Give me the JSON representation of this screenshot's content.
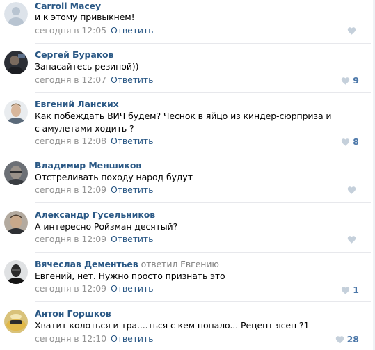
{
  "comments": [
    {
      "author": "Carroll Macey",
      "reply_to": "",
      "text": "и к этому привыкнем!",
      "time": "сегодня в 12:05",
      "reply_label": "Ответить",
      "likes": "",
      "avatar": "avatar-default"
    },
    {
      "author": "Сергей Бураков",
      "reply_to": "",
      "text": "Запасайтесь резиной))",
      "time": "сегодня в 12:07",
      "reply_label": "Ответить",
      "likes": "9",
      "avatar": "avatar-photo"
    },
    {
      "author": "Евгений Ланских",
      "reply_to": "",
      "text": "Как побеждать ВИЧ будем? Чеснок в яйцо из киндер-сюрприза и с амулетами ходить ?",
      "time": "сегодня в 12:08",
      "reply_label": "Ответить",
      "likes": "8",
      "avatar": "avatar-photo"
    },
    {
      "author": "Владимир Меншиков",
      "reply_to": "",
      "text": "Отстреливать походу народ будут",
      "time": "сегодня в 12:09",
      "reply_label": "Ответить",
      "likes": "",
      "avatar": "avatar-photo"
    },
    {
      "author": "Александр Гусельников",
      "reply_to": "",
      "text": "А интересно Ройзман десятый?",
      "time": "сегодня в 12:09",
      "reply_label": "Ответить",
      "likes": "",
      "avatar": "avatar-photo"
    },
    {
      "author": "Вячеслав Дементьев",
      "reply_to": "ответил Евгению",
      "text": "Евгений, нет. Нужно просто признать это",
      "time": "сегодня в 12:09",
      "reply_label": "Ответить",
      "likes": "1",
      "avatar": "avatar-photo"
    },
    {
      "author": "Антон Горшков",
      "reply_to": "",
      "text": "Хватит колоться и тра....ться с кем попало... Рецепт ясен ?1",
      "time": "сегодня в 12:10",
      "reply_label": "Ответить",
      "likes": "28",
      "avatar": "avatar-photo"
    }
  ],
  "colors": {
    "link": "#2a5885",
    "meta": "#939393",
    "like": "#4a76a8",
    "heart": "#c5d0db"
  },
  "icons": {
    "like": "heart-icon"
  }
}
